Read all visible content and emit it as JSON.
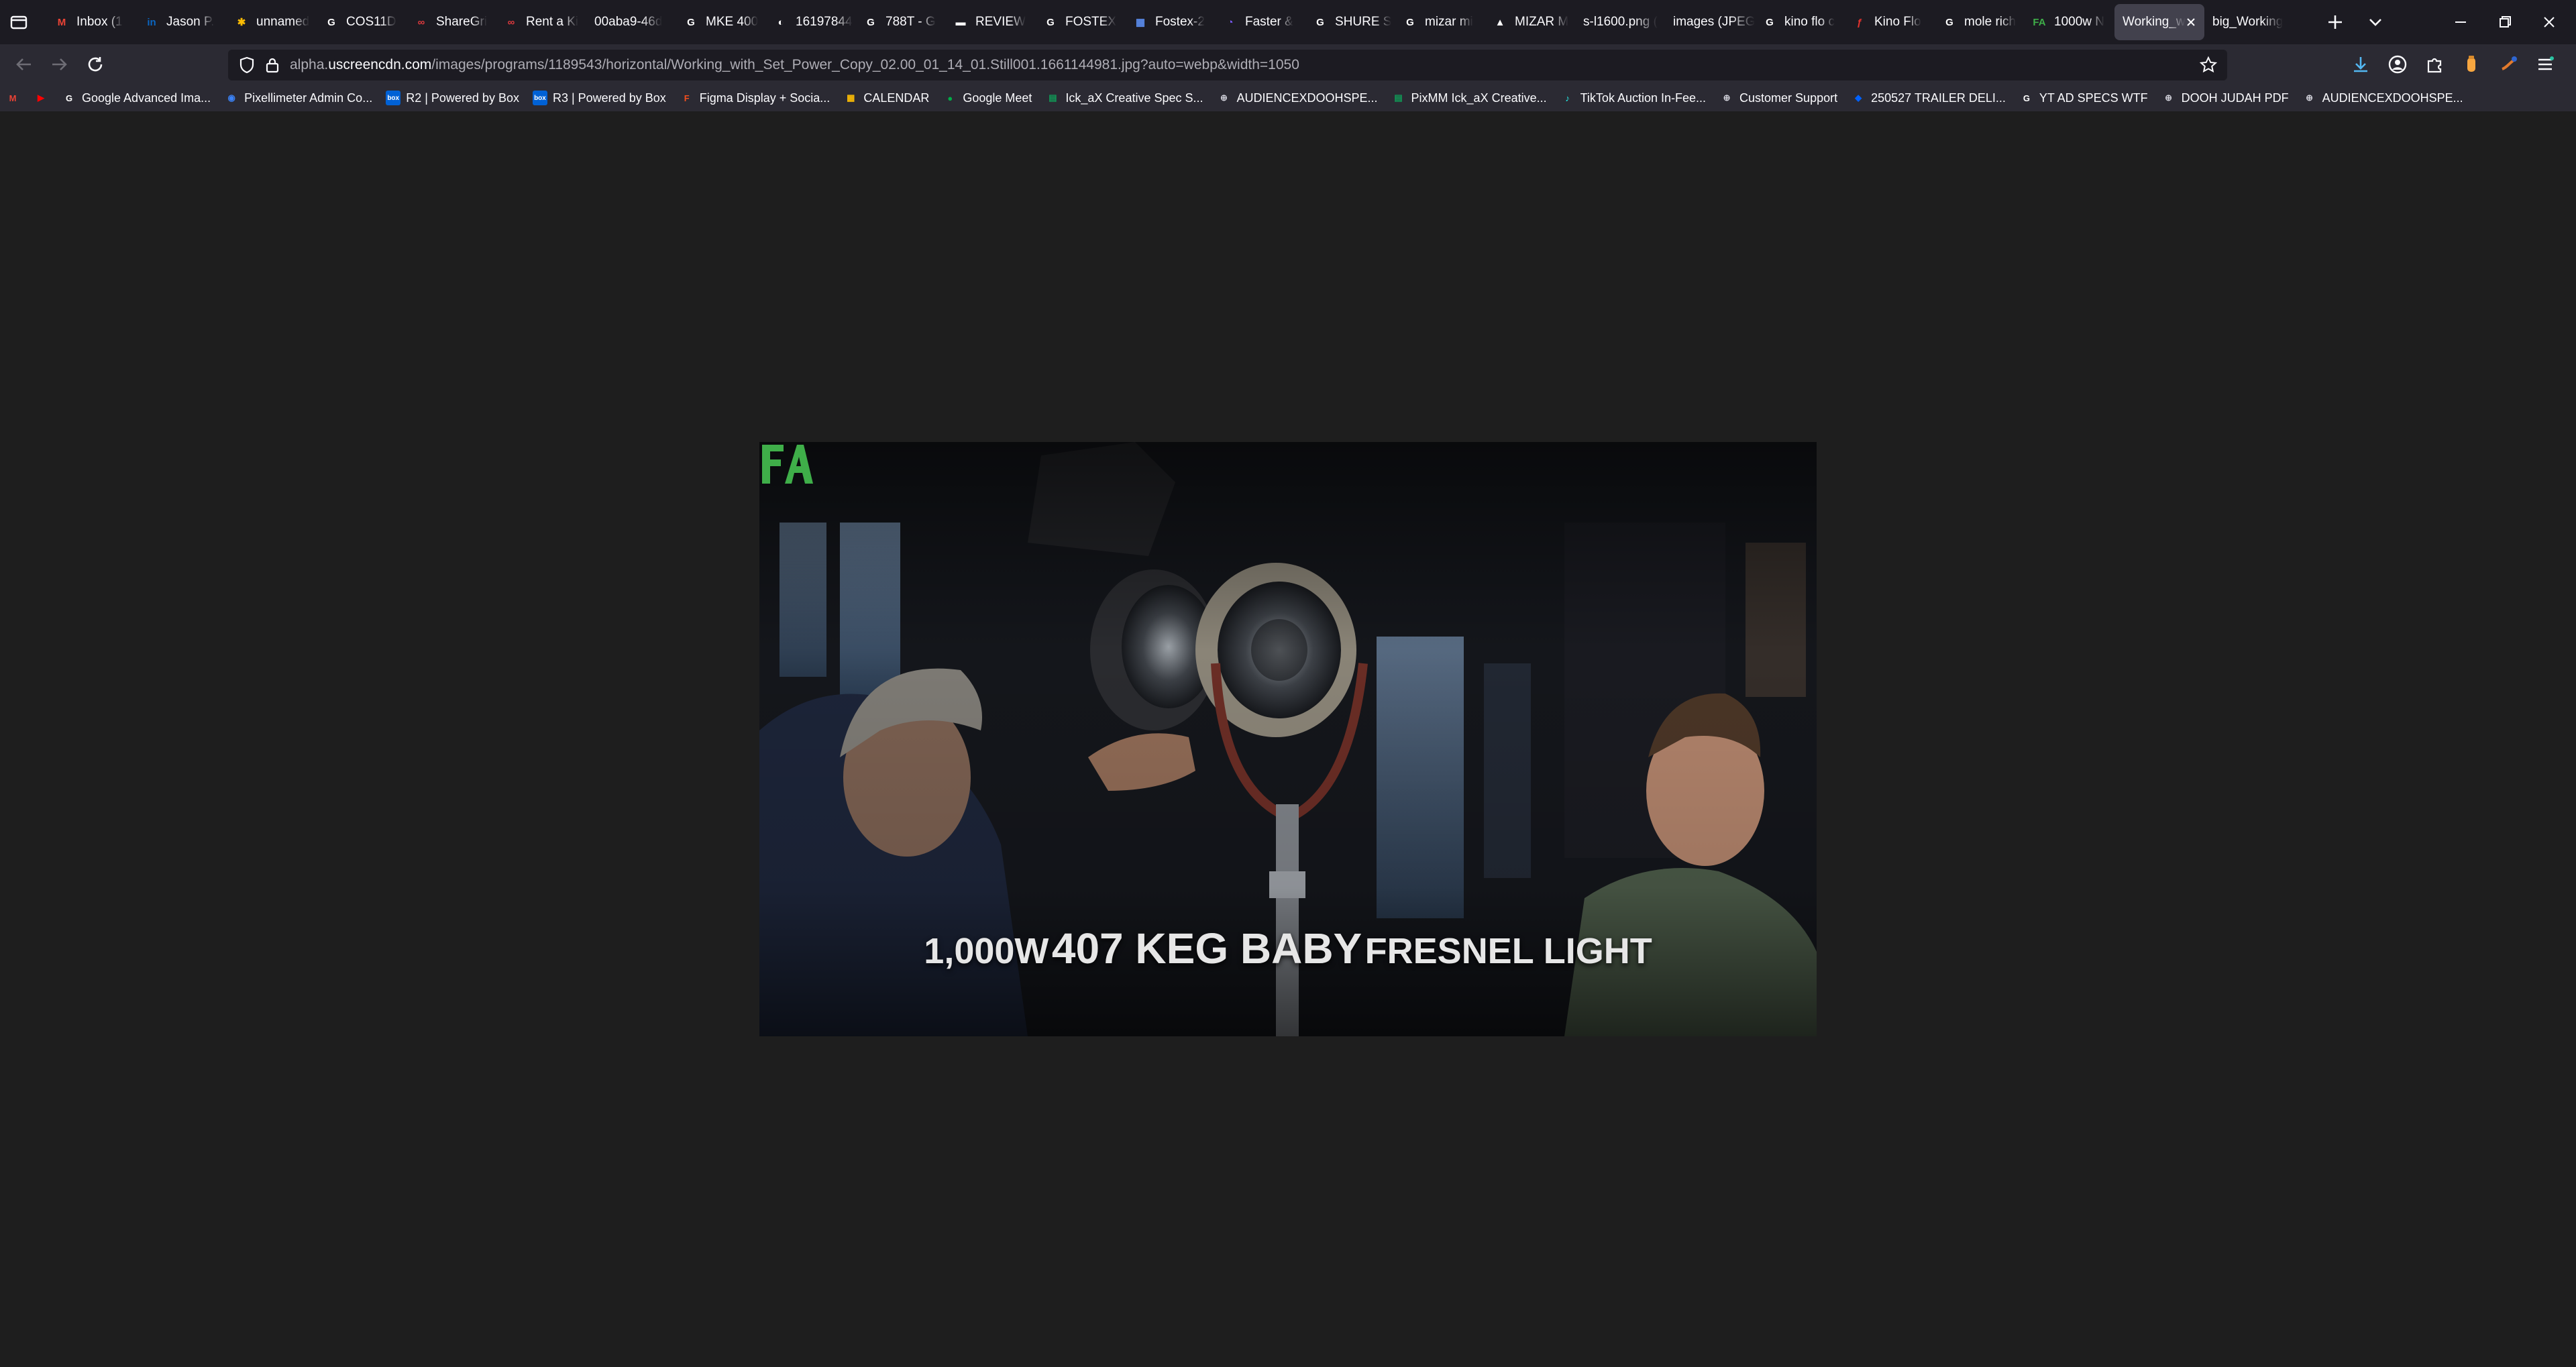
{
  "tabs": [
    {
      "title": "Inbox (1",
      "icon": "gmail-icon",
      "color": "#ea4335",
      "glyph": "M"
    },
    {
      "title": "Jason P.",
      "icon": "linkedin-icon",
      "color": "#0a66c2",
      "glyph": "in"
    },
    {
      "title": "unnamed",
      "icon": "google-photos-icon",
      "color": "#fbbc04",
      "glyph": "✱"
    },
    {
      "title": "COS11D",
      "icon": "google-icon",
      "color": "#ffffff",
      "glyph": "G"
    },
    {
      "title": "ShareGri",
      "icon": "sharegrid-icon",
      "color": "#e03a3e",
      "glyph": "∞"
    },
    {
      "title": "Rent a Ki",
      "icon": "sharegrid-icon",
      "color": "#e03a3e",
      "glyph": "∞"
    },
    {
      "title": "00aba9-46d",
      "icon": "",
      "color": "",
      "glyph": ""
    },
    {
      "title": "MKE 400",
      "icon": "google-icon",
      "color": "#ffffff",
      "glyph": "G"
    },
    {
      "title": "16197844",
      "icon": "globe-icon",
      "color": "#ffffff",
      "glyph": "◐"
    },
    {
      "title": "788T - G",
      "icon": "google-icon",
      "color": "#ffffff",
      "glyph": "G"
    },
    {
      "title": "REVIEW",
      "icon": "review-icon",
      "color": "#ffffff",
      "glyph": "▬"
    },
    {
      "title": "FOSTEX",
      "icon": "google-icon",
      "color": "#ffffff",
      "glyph": "G"
    },
    {
      "title": "Fostex-2",
      "icon": "document-icon",
      "color": "#5b8def",
      "glyph": "▦"
    },
    {
      "title": "Faster &",
      "icon": "app-icon",
      "color": "#7b5cff",
      "glyph": "◔"
    },
    {
      "title": "SHURE S",
      "icon": "google-icon",
      "color": "#ffffff",
      "glyph": "G"
    },
    {
      "title": "mizar mi",
      "icon": "google-icon",
      "color": "#ffffff",
      "glyph": "G"
    },
    {
      "title": "MIZAR M",
      "icon": "image-icon",
      "color": "#ffffff",
      "glyph": "▲"
    },
    {
      "title": "s-l1600.png (",
      "icon": "",
      "color": "",
      "glyph": ""
    },
    {
      "title": "images (JPEG",
      "icon": "",
      "color": "",
      "glyph": ""
    },
    {
      "title": "kino flo c",
      "icon": "google-icon",
      "color": "#ffffff",
      "glyph": "G"
    },
    {
      "title": "Kino Flo",
      "icon": "kinoflo-icon",
      "color": "#e5322d",
      "glyph": "ƒ"
    },
    {
      "title": "mole rich",
      "icon": "google-icon",
      "color": "#ffffff",
      "glyph": "G"
    },
    {
      "title": "1000w N",
      "icon": "filmmakers-academy-icon",
      "color": "#3fae49",
      "glyph": "FA"
    },
    {
      "title": "Working_w",
      "icon": "",
      "color": "",
      "glyph": "",
      "active": true
    },
    {
      "title": "big_Working",
      "icon": "",
      "color": "",
      "glyph": ""
    }
  ],
  "url": {
    "prefix": "alpha.",
    "host": "uscreencdn.com",
    "path": "/images/programs/1189543/horizontal/Working_with_Set_Power_Copy_02.00_01_14_01.Still001.1661144981.jpg?auto=webp&width=1050"
  },
  "bookmarks": [
    {
      "label": "",
      "icon": "gmail-icon",
      "color": "#ea4335",
      "glyph": "M"
    },
    {
      "label": "",
      "icon": "youtube-icon",
      "color": "#ff0000",
      "glyph": "▶"
    },
    {
      "label": "Google Advanced Ima...",
      "icon": "google-icon",
      "color": "#ffffff",
      "glyph": "G"
    },
    {
      "label": "Pixellimeter Admin Co...",
      "icon": "pixellimeter-icon",
      "color": "#3b82f6",
      "glyph": "◉"
    },
    {
      "label": "R2 | Powered by Box",
      "icon": "box-icon",
      "color": "#0061d5",
      "glyph": "box"
    },
    {
      "label": "R3 | Powered by Box",
      "icon": "box-icon",
      "color": "#0061d5",
      "glyph": "box"
    },
    {
      "label": "Figma Display + Socia...",
      "icon": "figma-icon",
      "color": "#f24e1e",
      "glyph": "F"
    },
    {
      "label": "CALENDAR",
      "icon": "calendar-icon",
      "color": "#fbbc04",
      "glyph": "▦"
    },
    {
      "label": "Google Meet",
      "icon": "google-meet-icon",
      "color": "#00ac47",
      "glyph": "●"
    },
    {
      "label": "Ick_aX Creative Spec S...",
      "icon": "sheets-icon",
      "color": "#0f9d58",
      "glyph": "▤"
    },
    {
      "label": "AUDIENCEXDOOHSPE...",
      "icon": "globe-icon",
      "color": "#cfcfd8",
      "glyph": "⊕"
    },
    {
      "label": "PixMM Ick_aX Creative...",
      "icon": "sheets-icon",
      "color": "#0f9d58",
      "glyph": "▤"
    },
    {
      "label": "TikTok Auction In-Fee...",
      "icon": "tiktok-icon",
      "color": "#25f4ee",
      "glyph": "♪"
    },
    {
      "label": "Customer Support",
      "icon": "globe-icon",
      "color": "#cfcfd8",
      "glyph": "⊕"
    },
    {
      "label": "250527 TRAILER DELI...",
      "icon": "dropbox-icon",
      "color": "#0061fe",
      "glyph": "◆"
    },
    {
      "label": "YT AD SPECS WTF",
      "icon": "google-icon",
      "color": "#ffffff",
      "glyph": "G"
    },
    {
      "label": "DOOH JUDAH PDF",
      "icon": "globe-icon",
      "color": "#cfcfd8",
      "glyph": "⊕"
    },
    {
      "label": "AUDIENCEXDOOHSPE...",
      "icon": "globe-icon",
      "color": "#cfcfd8",
      "glyph": "⊕"
    }
  ],
  "image": {
    "caption_pre": "1,000W",
    "caption_big": "407 KEG BABY",
    "caption_post": "FRESNEL LIGHT",
    "logo": "FA",
    "logo_color": "#3fae49"
  },
  "colors": {
    "page_bg": "#1e1e1e",
    "toolbar_bg": "#2b2a33",
    "tabbar_bg": "#1c1b22"
  }
}
